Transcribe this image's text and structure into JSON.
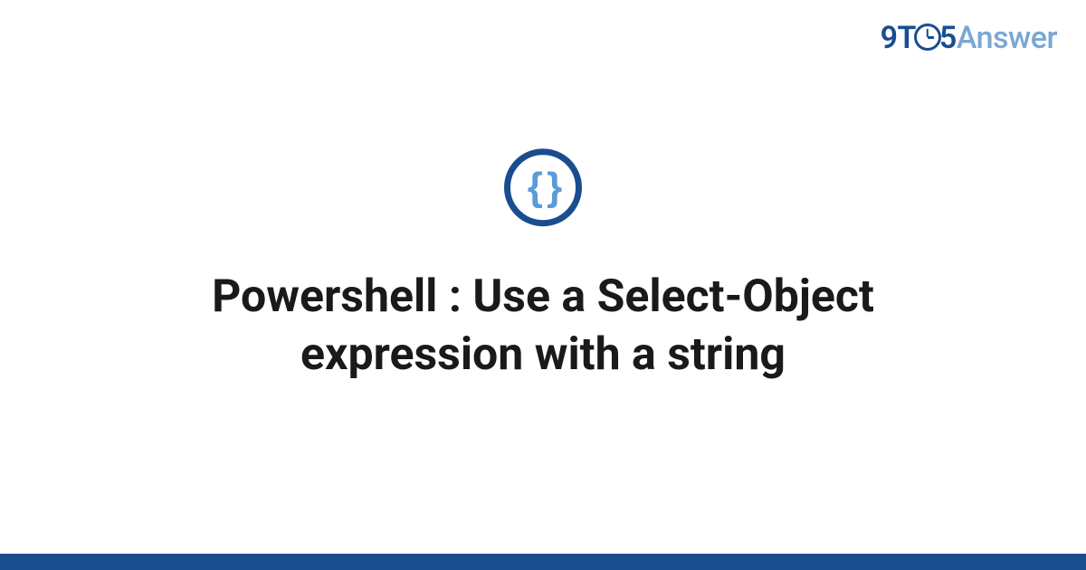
{
  "logo": {
    "part1": "9T",
    "part2": "5",
    "part3": "Answer"
  },
  "icon": {
    "braces": "{ }",
    "name": "code-braces-icon"
  },
  "title": "Powershell : Use a Select-Object expression with a string",
  "colors": {
    "brand_dark": "#1a4d8f",
    "brand_light": "#7aa7d4",
    "icon_inner": "#5a9bd8"
  }
}
